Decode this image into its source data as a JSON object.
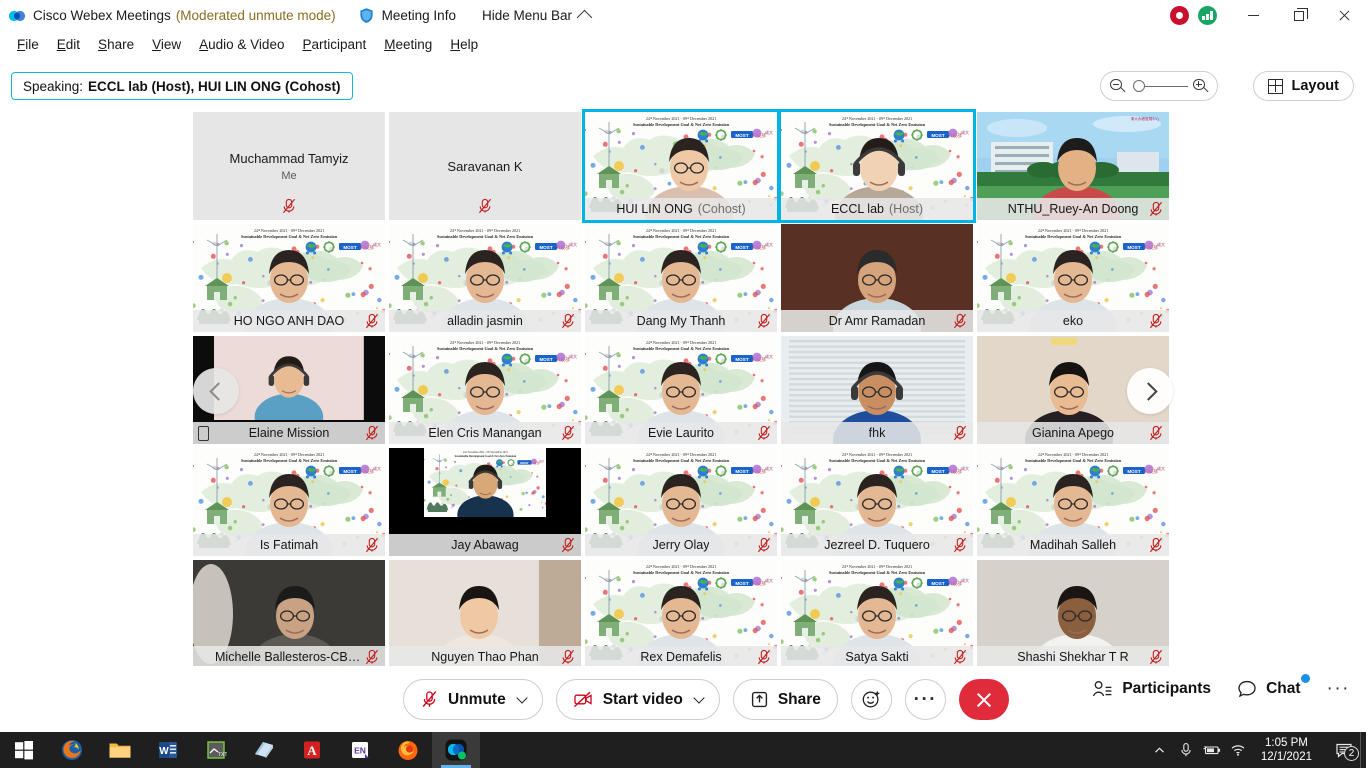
{
  "titlebar": {
    "app_name": "Cisco Webex Meetings",
    "mode": "(Moderated unmute mode)",
    "meeting_info": "Meeting Info",
    "hide_menu_bar": "Hide Menu Bar",
    "recording_icon": "record-indicator-icon",
    "connection_icon": "connection-strength-icon",
    "minimize": "minimize-button",
    "maximize": "restore-button",
    "close": "close-button"
  },
  "menubar": {
    "items": [
      {
        "label": "File",
        "accel": "F"
      },
      {
        "label": "Edit",
        "accel": "E"
      },
      {
        "label": "Share",
        "accel": "S"
      },
      {
        "label": "View",
        "accel": "V"
      },
      {
        "label": "Audio & Video",
        "accel": "A"
      },
      {
        "label": "Participant",
        "accel": "P"
      },
      {
        "label": "Meeting",
        "accel": "M"
      },
      {
        "label": "Help",
        "accel": "H"
      }
    ]
  },
  "speaking_bar": {
    "label": "Speaking:",
    "names": "ECCL lab (Host), HUI LIN ONG (Cohost)",
    "border_color": "#14b8d4"
  },
  "zoom_control": {
    "zoom_out_icon": "zoom-out-icon",
    "zoom_in_icon": "zoom-in-icon",
    "slider_position_percent": 8
  },
  "layout_button": {
    "label": "Layout",
    "icon": "grid-layout-icon"
  },
  "grid": {
    "nav_prev": "previous-page-arrow",
    "nav_next": "next-page-arrow",
    "active_color": "#00b5e2",
    "tiles": [
      {
        "name": "Muchammad Tamyiz",
        "sub": "Me",
        "role": "",
        "video": false,
        "muted": true,
        "active": false,
        "phone": false,
        "bg": "placeholder"
      },
      {
        "name": "Saravanan K",
        "sub": "",
        "role": "",
        "video": false,
        "muted": true,
        "active": false,
        "phone": false,
        "bg": "placeholder"
      },
      {
        "name": "HUI LIN ONG",
        "sub": "",
        "role": "(Cohost)",
        "video": true,
        "muted": false,
        "active": true,
        "phone": false,
        "bg": "vbg-conf-woman"
      },
      {
        "name": "ECCL lab",
        "sub": "",
        "role": "(Host)",
        "video": true,
        "muted": false,
        "active": true,
        "phone": false,
        "bg": "vbg-conf-headset"
      },
      {
        "name": "NTHU_Ruey-An Doong",
        "sub": "",
        "role": "",
        "video": true,
        "muted": true,
        "active": false,
        "phone": false,
        "bg": "vbg-campus"
      },
      {
        "name": "HO NGO ANH DAO",
        "sub": "",
        "role": "",
        "video": true,
        "muted": true,
        "active": false,
        "phone": false,
        "bg": "vbg-conf"
      },
      {
        "name": "alladin jasmin",
        "sub": "",
        "role": "",
        "video": true,
        "muted": true,
        "active": false,
        "phone": false,
        "bg": "vbg-conf"
      },
      {
        "name": "Dang My Thanh",
        "sub": "",
        "role": "",
        "video": true,
        "muted": true,
        "active": false,
        "phone": false,
        "bg": "vbg-conf"
      },
      {
        "name": "Dr Amr Ramadan",
        "sub": "",
        "role": "",
        "video": true,
        "muted": true,
        "active": false,
        "phone": false,
        "bg": "vbg-dark-room"
      },
      {
        "name": "eko",
        "sub": "",
        "role": "",
        "video": true,
        "muted": true,
        "active": false,
        "phone": false,
        "bg": "vbg-conf"
      },
      {
        "name": "Elaine Mission",
        "sub": "",
        "role": "",
        "video": true,
        "muted": true,
        "active": false,
        "phone": true,
        "bg": "vbg-pillar"
      },
      {
        "name": "Elen Cris Manangan",
        "sub": "",
        "role": "",
        "video": true,
        "muted": true,
        "active": false,
        "phone": false,
        "bg": "vbg-conf"
      },
      {
        "name": "Evie Laurito",
        "sub": "",
        "role": "",
        "video": true,
        "muted": true,
        "active": false,
        "phone": false,
        "bg": "vbg-conf"
      },
      {
        "name": "fhk",
        "sub": "",
        "role": "",
        "video": true,
        "muted": true,
        "active": false,
        "phone": false,
        "bg": "vbg-blinds"
      },
      {
        "name": "Gianina Apego",
        "sub": "",
        "role": "",
        "video": true,
        "muted": true,
        "active": false,
        "phone": false,
        "bg": "vbg-beige"
      },
      {
        "name": "Is Fatimah",
        "sub": "",
        "role": "",
        "video": true,
        "muted": true,
        "active": false,
        "phone": false,
        "bg": "vbg-conf"
      },
      {
        "name": "Jay Abawag",
        "sub": "",
        "role": "",
        "video": true,
        "muted": true,
        "active": false,
        "phone": false,
        "bg": "vbg-conf-pillar"
      },
      {
        "name": "Jerry Olay",
        "sub": "",
        "role": "",
        "video": true,
        "muted": true,
        "active": false,
        "phone": false,
        "bg": "vbg-conf"
      },
      {
        "name": "Jezreel D. Tuquero",
        "sub": "",
        "role": "",
        "video": true,
        "muted": true,
        "active": false,
        "phone": false,
        "bg": "vbg-conf"
      },
      {
        "name": "Madihah Salleh",
        "sub": "",
        "role": "",
        "video": true,
        "muted": true,
        "active": false,
        "phone": false,
        "bg": "vbg-conf"
      },
      {
        "name": "Michelle Ballesteros-CBSUA...",
        "sub": "",
        "role": "",
        "video": true,
        "muted": true,
        "active": false,
        "phone": false,
        "bg": "vbg-dim"
      },
      {
        "name": "Nguyen Thao Phan",
        "sub": "",
        "role": "",
        "video": true,
        "muted": true,
        "active": false,
        "phone": false,
        "bg": "vbg-plain"
      },
      {
        "name": "Rex Demafelis",
        "sub": "",
        "role": "",
        "video": true,
        "muted": true,
        "active": false,
        "phone": false,
        "bg": "vbg-conf"
      },
      {
        "name": "Satya Sakti",
        "sub": "",
        "role": "",
        "video": true,
        "muted": true,
        "active": false,
        "phone": false,
        "bg": "vbg-conf"
      },
      {
        "name": "Shashi Shekhar T R",
        "sub": "",
        "role": "",
        "video": true,
        "muted": true,
        "active": false,
        "phone": false,
        "bg": "vbg-grey"
      }
    ],
    "virtual_bg_text_line1": "24ᵗʰ November 2021 - 09ᵗʰ December 2021",
    "virtual_bg_text_line2": "Sustainable Development Goal & Net Zero Emission"
  },
  "controls": {
    "unmute": "Unmute",
    "start_video": "Start video",
    "share": "Share",
    "reactions_icon": "reactions-smiley-icon",
    "more_icon": "more-options-icon",
    "end_icon": "end-meeting-icon",
    "participants": "Participants",
    "chat": "Chat",
    "right_more_icon": "more-options-right-icon",
    "end_color": "#e02b3b",
    "chat_badge_color": "#1a8fe3"
  },
  "taskbar": {
    "start": "start-button",
    "apps": [
      {
        "name": "firefox-old-icon",
        "active": false
      },
      {
        "name": "file-explorer-icon",
        "active": false
      },
      {
        "name": "microsoft-word-icon",
        "active": false
      },
      {
        "name": "text-editor-icon",
        "active": false
      },
      {
        "name": "sticky-notes-icon",
        "active": false
      },
      {
        "name": "adobe-acrobat-icon",
        "active": false
      },
      {
        "name": "endnote-icon",
        "active": false
      },
      {
        "name": "firefox-icon",
        "active": false
      },
      {
        "name": "webex-icon",
        "active": true
      }
    ],
    "tray": {
      "chevron": "show-hidden-icons",
      "mic": "microphone-icon",
      "battery": "battery-icon",
      "wifi": "wifi-icon",
      "time": "1:05 PM",
      "date": "12/1/2021",
      "notification_count": "2"
    }
  }
}
